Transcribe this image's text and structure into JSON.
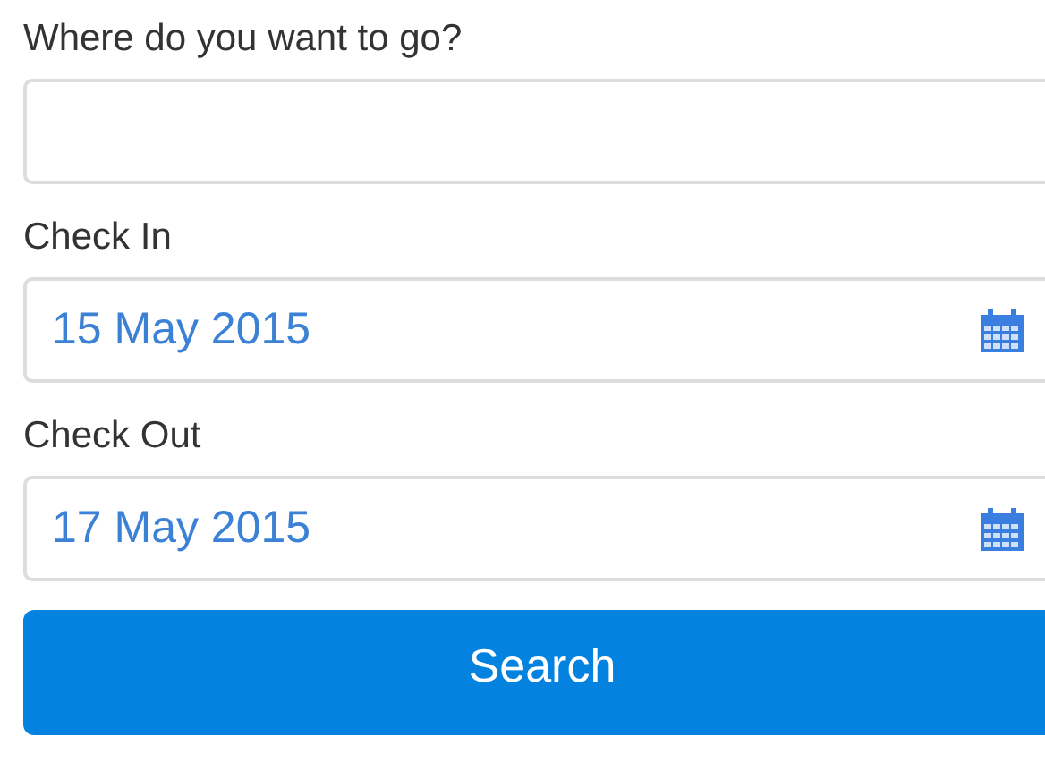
{
  "fields": [
    {
      "label": "Where do you want to go?",
      "kind": "text"
    },
    {
      "label": "Check In",
      "kind": "date",
      "value": "15 May 2015"
    },
    {
      "label": "Check Out",
      "kind": "date",
      "value": "17 May 2015"
    }
  ],
  "search_button": {
    "label": "Search"
  }
}
